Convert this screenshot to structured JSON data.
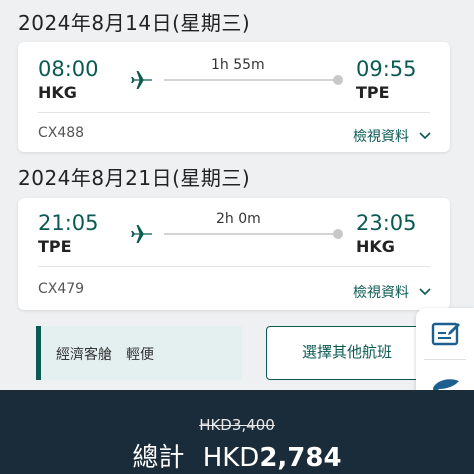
{
  "flights": [
    {
      "date": "2024年8月14日(星期三)",
      "dep_time": "08:00",
      "dep_code": "HKG",
      "duration": "1h 55m",
      "arr_time": "09:55",
      "arr_code": "TPE",
      "flight_no": "CX488",
      "details_label": "檢視資料"
    },
    {
      "date": "2024年8月21日(星期三)",
      "dep_time": "21:05",
      "dep_code": "TPE",
      "duration": "2h 0m",
      "arr_time": "23:05",
      "arr_code": "HKG",
      "flight_no": "CX479",
      "details_label": "檢視資料"
    }
  ],
  "fare": {
    "cabin_label": "經濟客艙　輕便",
    "other_flights_button": "選擇其他航班"
  },
  "side_actions": [
    "edit-note-icon",
    "chat-icon"
  ],
  "footer": {
    "old_price": "HKD3,400",
    "total_label": "總計",
    "currency": "HKD",
    "total_amount": "2,784"
  },
  "colors": {
    "accent": "#0b5a52",
    "footer_bg": "#1a2b3a",
    "cabin_bg": "#e4efef",
    "side_icon": "#1d5f8f"
  }
}
